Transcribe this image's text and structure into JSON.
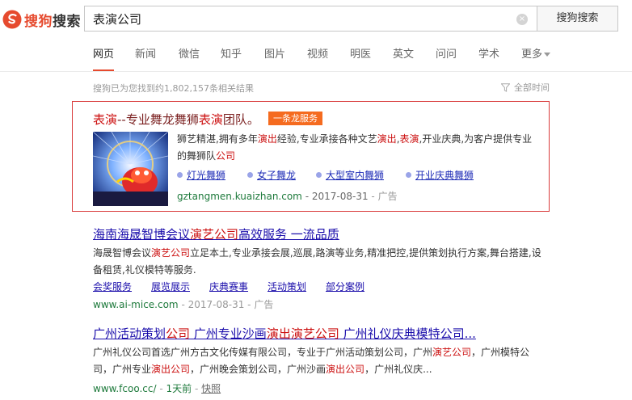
{
  "header": {
    "logo_prefix": "搜狗",
    "logo_suffix": "搜索",
    "query": "表演公司",
    "clear_label": "×",
    "search_button": "搜狗搜索"
  },
  "nav": {
    "items": [
      "网页",
      "新闻",
      "微信",
      "知乎",
      "图片",
      "视频",
      "明医",
      "英文",
      "问问",
      "学术",
      "更多"
    ],
    "active": "网页"
  },
  "results_meta": {
    "count_text": "搜狗已为您找到约1,802,157条相关结果",
    "time_filter": "全部时间"
  },
  "ad": {
    "title_hl1": "表演",
    "title_mid": "--专业舞龙舞狮",
    "title_hl2": "表演",
    "title_end": "团队。",
    "badge": "一条龙服务",
    "desc_1": "狮艺精湛,拥有多年",
    "desc_hl1": "演出",
    "desc_2": "经验,专业承接各种文艺",
    "desc_hl2": "演出",
    "desc_3": ",",
    "desc_hl3": "表演",
    "desc_4": ",开业庆典,为客户提供专业的舞狮队",
    "desc_hl4": "公司",
    "links": [
      "灯光舞狮",
      "女子舞龙",
      "大型室内舞狮",
      "开业庆典舞狮"
    ],
    "url": "gztangmen.kuaizhan.com",
    "date": "- 2017-08-31",
    "ad_tag": "- 广告"
  },
  "results": [
    {
      "title_pre": "海南海晟智博会议",
      "title_hl": "演艺公司",
      "title_post": "高效服务 一流品质",
      "desc_pre": "海晟智博会议",
      "desc_hl": "演艺公司",
      "desc_post": "立足本土,专业承接会展,巡展,路演等业务,精准把控,提供策划执行方案,舞台搭建,设备租赁,礼仪模特等服务.",
      "sublinks": [
        "会奖服务",
        "展览展示",
        "庆典赛事",
        "活动策划",
        "部分案例"
      ],
      "url": "www.ai-mice.com",
      "date": "- 2017-08-31",
      "ad_tag": "- 广告"
    },
    {
      "title_pre": "广州活动策划",
      "title_hl1": "公司",
      "title_mid": " 广州专业沙画",
      "title_hl2": "演出演艺公司",
      "title_post": " 广州礼仪庆典模特公司...",
      "desc_1": "广州礼仪公司首选广州方古文化传媒有限公司，专业于广州活动策划公司，广州",
      "desc_hl1": "演艺公司",
      "desc_2": "，广州模特公司，广州专业",
      "desc_hl2": "演出公司",
      "desc_3": "，广州晚会策划公司，广州沙画",
      "desc_hl3": "演出公司",
      "desc_4": "，广州礼仪庆...",
      "url": "www.fcoo.cc/",
      "age": "1天前",
      "snapshot": "快照"
    }
  ]
}
